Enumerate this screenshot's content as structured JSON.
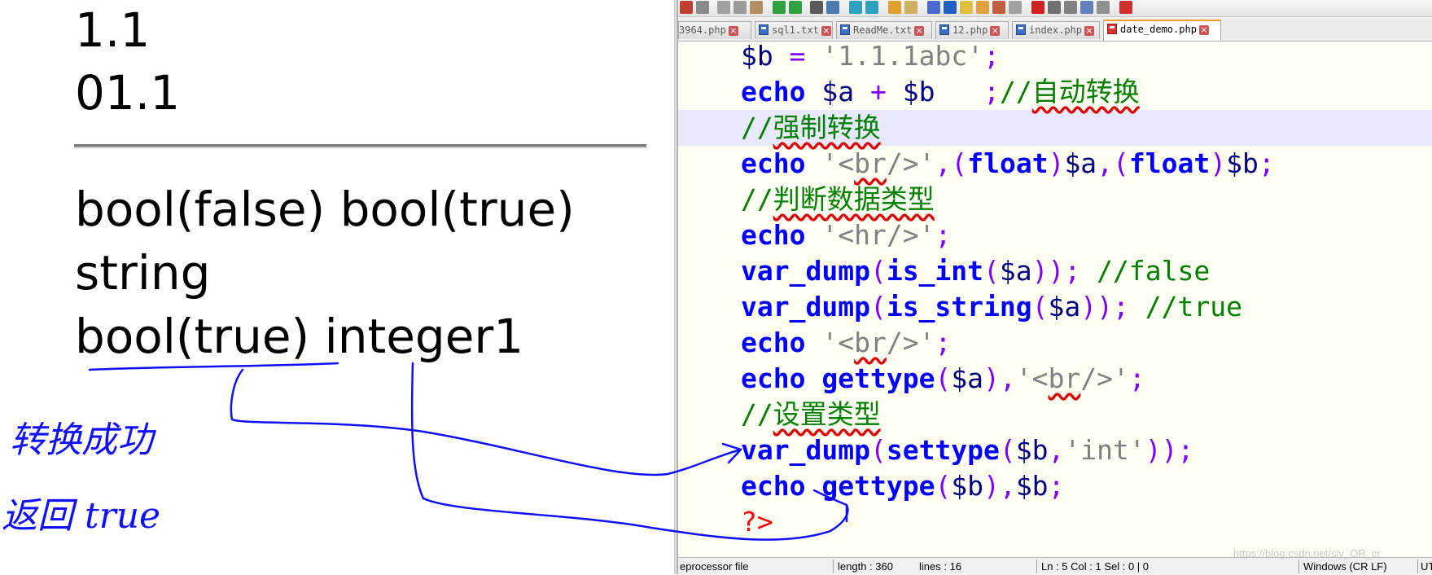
{
  "output": {
    "lines": [
      "1.1",
      "01.1",
      "bool(false) bool(true)",
      "string",
      "bool(true) integer1"
    ]
  },
  "tabs": [
    {
      "label": "3964.php",
      "active": false
    },
    {
      "label": "sql1.txt",
      "active": false
    },
    {
      "label": "ReadMe.txt",
      "active": false
    },
    {
      "label": "12.php",
      "active": false
    },
    {
      "label": "index.php",
      "active": false
    },
    {
      "label": "date_demo.php",
      "active": true
    }
  ],
  "code": {
    "highlighted_line": 3,
    "lines": [
      "$b = '1.1.1abc';",
      "echo $a + $b   ;//自动转换",
      "//强制转换",
      "echo '<br/>',(float)$a,(float)$b;",
      "//判断数据类型",
      "echo '<hr/>';",
      "var_dump(is_int($a)); //false",
      "var_dump(is_string($a)); //true",
      "echo '<br/>';",
      "echo gettype($a),'<br/>';",
      "//设置类型",
      "var_dump(settype($b,'int'));",
      "echo gettype($b),$b;",
      "?>"
    ]
  },
  "statusbar": {
    "file_type": "eprocessor file",
    "length": "length : 360",
    "lines": "lines : 16",
    "position": "Ln : 5    Col : 1    Sel : 0 | 0",
    "eol": "Windows (CR LF)",
    "encoding": "UT"
  },
  "annotation": {
    "line1": "转换成功",
    "line2": "返回 true"
  },
  "watermark": "https://blog.csdn.net/sly_OR_cr"
}
